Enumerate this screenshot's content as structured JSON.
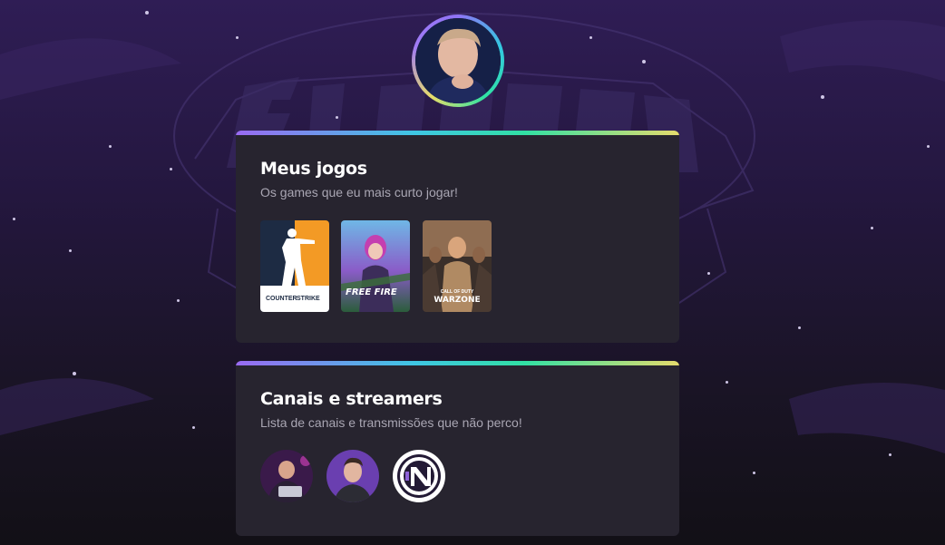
{
  "profile": {
    "avatar_icon": "profile-avatar"
  },
  "games_section": {
    "title": "Meus jogos",
    "subtitle": "Os games que eu mais curto jogar!",
    "games": [
      {
        "icon": "counter-strike-cover",
        "caption_line1": "COUNTER",
        "caption_line2": "STRIKE",
        "accent": "#f39a25"
      },
      {
        "icon": "free-fire-cover",
        "caption": "FREE FIRE",
        "accent": "#ee7b1a"
      },
      {
        "icon": "warzone-cover",
        "caption_top": "CALL OF DUTY",
        "caption": "WARZONE",
        "accent": "#c9a26b"
      }
    ]
  },
  "streamers_section": {
    "title": "Canais e streamers",
    "subtitle": "Lista de canais e transmissões que não perco!",
    "streamers": [
      {
        "icon": "streamer-1-avatar"
      },
      {
        "icon": "streamer-2-avatar"
      },
      {
        "icon": "streamer-3-logo"
      }
    ]
  },
  "colors": {
    "card_bg": "#27242f",
    "gradient": [
      "#9a6af2",
      "#3fc6e4",
      "#31e0a4",
      "#e5dc6c"
    ],
    "title": "#ffffff",
    "subtitle": "#a9a6b3"
  }
}
